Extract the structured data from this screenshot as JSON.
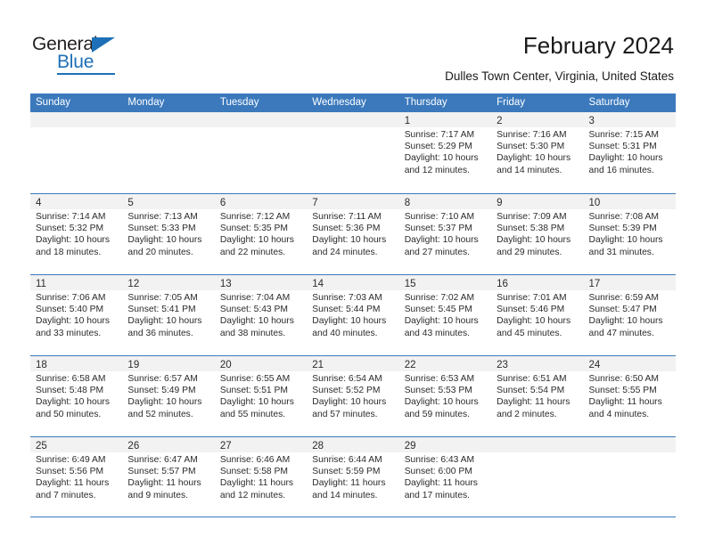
{
  "brand": {
    "name_top": "General",
    "name_bottom": "Blue",
    "accent_color": "#1d70b7"
  },
  "header": {
    "title": "February 2024",
    "subtitle": "Dulles Town Center, Virginia, United States"
  },
  "calendar": {
    "header_bg": "#3b79bc",
    "daynum_bg": "#f2f2f2",
    "weekdays": [
      "Sunday",
      "Monday",
      "Tuesday",
      "Wednesday",
      "Thursday",
      "Friday",
      "Saturday"
    ],
    "weeks": [
      [
        {
          "day": "",
          "lines": []
        },
        {
          "day": "",
          "lines": []
        },
        {
          "day": "",
          "lines": []
        },
        {
          "day": "",
          "lines": []
        },
        {
          "day": "1",
          "lines": [
            "Sunrise: 7:17 AM",
            "Sunset: 5:29 PM",
            "Daylight: 10 hours",
            "and 12 minutes."
          ]
        },
        {
          "day": "2",
          "lines": [
            "Sunrise: 7:16 AM",
            "Sunset: 5:30 PM",
            "Daylight: 10 hours",
            "and 14 minutes."
          ]
        },
        {
          "day": "3",
          "lines": [
            "Sunrise: 7:15 AM",
            "Sunset: 5:31 PM",
            "Daylight: 10 hours",
            "and 16 minutes."
          ]
        }
      ],
      [
        {
          "day": "4",
          "lines": [
            "Sunrise: 7:14 AM",
            "Sunset: 5:32 PM",
            "Daylight: 10 hours",
            "and 18 minutes."
          ]
        },
        {
          "day": "5",
          "lines": [
            "Sunrise: 7:13 AM",
            "Sunset: 5:33 PM",
            "Daylight: 10 hours",
            "and 20 minutes."
          ]
        },
        {
          "day": "6",
          "lines": [
            "Sunrise: 7:12 AM",
            "Sunset: 5:35 PM",
            "Daylight: 10 hours",
            "and 22 minutes."
          ]
        },
        {
          "day": "7",
          "lines": [
            "Sunrise: 7:11 AM",
            "Sunset: 5:36 PM",
            "Daylight: 10 hours",
            "and 24 minutes."
          ]
        },
        {
          "day": "8",
          "lines": [
            "Sunrise: 7:10 AM",
            "Sunset: 5:37 PM",
            "Daylight: 10 hours",
            "and 27 minutes."
          ]
        },
        {
          "day": "9",
          "lines": [
            "Sunrise: 7:09 AM",
            "Sunset: 5:38 PM",
            "Daylight: 10 hours",
            "and 29 minutes."
          ]
        },
        {
          "day": "10",
          "lines": [
            "Sunrise: 7:08 AM",
            "Sunset: 5:39 PM",
            "Daylight: 10 hours",
            "and 31 minutes."
          ]
        }
      ],
      [
        {
          "day": "11",
          "lines": [
            "Sunrise: 7:06 AM",
            "Sunset: 5:40 PM",
            "Daylight: 10 hours",
            "and 33 minutes."
          ]
        },
        {
          "day": "12",
          "lines": [
            "Sunrise: 7:05 AM",
            "Sunset: 5:41 PM",
            "Daylight: 10 hours",
            "and 36 minutes."
          ]
        },
        {
          "day": "13",
          "lines": [
            "Sunrise: 7:04 AM",
            "Sunset: 5:43 PM",
            "Daylight: 10 hours",
            "and 38 minutes."
          ]
        },
        {
          "day": "14",
          "lines": [
            "Sunrise: 7:03 AM",
            "Sunset: 5:44 PM",
            "Daylight: 10 hours",
            "and 40 minutes."
          ]
        },
        {
          "day": "15",
          "lines": [
            "Sunrise: 7:02 AM",
            "Sunset: 5:45 PM",
            "Daylight: 10 hours",
            "and 43 minutes."
          ]
        },
        {
          "day": "16",
          "lines": [
            "Sunrise: 7:01 AM",
            "Sunset: 5:46 PM",
            "Daylight: 10 hours",
            "and 45 minutes."
          ]
        },
        {
          "day": "17",
          "lines": [
            "Sunrise: 6:59 AM",
            "Sunset: 5:47 PM",
            "Daylight: 10 hours",
            "and 47 minutes."
          ]
        }
      ],
      [
        {
          "day": "18",
          "lines": [
            "Sunrise: 6:58 AM",
            "Sunset: 5:48 PM",
            "Daylight: 10 hours",
            "and 50 minutes."
          ]
        },
        {
          "day": "19",
          "lines": [
            "Sunrise: 6:57 AM",
            "Sunset: 5:49 PM",
            "Daylight: 10 hours",
            "and 52 minutes."
          ]
        },
        {
          "day": "20",
          "lines": [
            "Sunrise: 6:55 AM",
            "Sunset: 5:51 PM",
            "Daylight: 10 hours",
            "and 55 minutes."
          ]
        },
        {
          "day": "21",
          "lines": [
            "Sunrise: 6:54 AM",
            "Sunset: 5:52 PM",
            "Daylight: 10 hours",
            "and 57 minutes."
          ]
        },
        {
          "day": "22",
          "lines": [
            "Sunrise: 6:53 AM",
            "Sunset: 5:53 PM",
            "Daylight: 10 hours",
            "and 59 minutes."
          ]
        },
        {
          "day": "23",
          "lines": [
            "Sunrise: 6:51 AM",
            "Sunset: 5:54 PM",
            "Daylight: 11 hours",
            "and 2 minutes."
          ]
        },
        {
          "day": "24",
          "lines": [
            "Sunrise: 6:50 AM",
            "Sunset: 5:55 PM",
            "Daylight: 11 hours",
            "and 4 minutes."
          ]
        }
      ],
      [
        {
          "day": "25",
          "lines": [
            "Sunrise: 6:49 AM",
            "Sunset: 5:56 PM",
            "Daylight: 11 hours",
            "and 7 minutes."
          ]
        },
        {
          "day": "26",
          "lines": [
            "Sunrise: 6:47 AM",
            "Sunset: 5:57 PM",
            "Daylight: 11 hours",
            "and 9 minutes."
          ]
        },
        {
          "day": "27",
          "lines": [
            "Sunrise: 6:46 AM",
            "Sunset: 5:58 PM",
            "Daylight: 11 hours",
            "and 12 minutes."
          ]
        },
        {
          "day": "28",
          "lines": [
            "Sunrise: 6:44 AM",
            "Sunset: 5:59 PM",
            "Daylight: 11 hours",
            "and 14 minutes."
          ]
        },
        {
          "day": "29",
          "lines": [
            "Sunrise: 6:43 AM",
            "Sunset: 6:00 PM",
            "Daylight: 11 hours",
            "and 17 minutes."
          ]
        },
        {
          "day": "",
          "lines": []
        },
        {
          "day": "",
          "lines": []
        }
      ]
    ]
  }
}
